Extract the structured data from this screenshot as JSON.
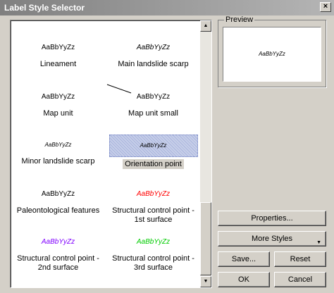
{
  "window": {
    "title": "Label Style Selector",
    "close_glyph": "×"
  },
  "preview": {
    "legend": "Preview",
    "sample": "AaBbYyZz"
  },
  "styles": [
    {
      "sample": "AaBbYyZz",
      "name": "Lineament",
      "color": "#000000"
    },
    {
      "sample": "AaBbYyZz",
      "name": "Main landslide scarp",
      "color": "#000000"
    },
    {
      "sample": "AaBbYyZz",
      "name": "Map unit",
      "color": "#000000"
    },
    {
      "sample": "AaBbYyZz",
      "name": "Map unit small",
      "color": "#000000"
    },
    {
      "sample": "AaBbYyZz",
      "name": "Minor landslide scarp",
      "color": "#000000"
    },
    {
      "sample": "AaBbYyZz",
      "name": "Orientation point",
      "color": "#000000",
      "selected": true
    },
    {
      "sample": "AaBbYyZz",
      "name": "Paleontological features",
      "color": "#000000"
    },
    {
      "sample": "AaBbYyZz",
      "name": "Structural control point - 1st surface",
      "color": "#ff0000"
    },
    {
      "sample": "AaBbYyZz",
      "name": "Structural control point - 2nd surface",
      "color": "#8000ff"
    },
    {
      "sample": "AaBbYyZz",
      "name": "Structural control point - 3rd surface",
      "color": "#00cc00"
    }
  ],
  "buttons": {
    "properties": "Properties...",
    "more_styles": "More Styles",
    "save": "Save...",
    "reset": "Reset",
    "ok": "OK",
    "cancel": "Cancel"
  },
  "scrollbar": {
    "up": "▲",
    "down": "▼"
  }
}
